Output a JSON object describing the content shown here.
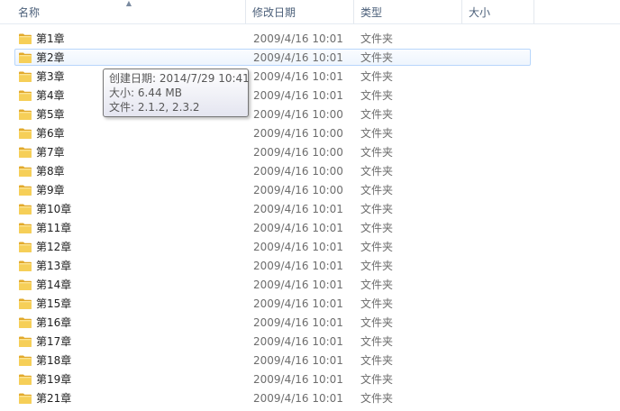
{
  "columns": {
    "name": "名称",
    "date": "修改日期",
    "type": "类型",
    "size": "大小"
  },
  "rows": [
    {
      "name": "第1章",
      "date": "2009/4/16 10:01",
      "type": "文件夹"
    },
    {
      "name": "第2章",
      "date": "2009/4/16 10:01",
      "type": "文件夹"
    },
    {
      "name": "第3章",
      "date": "2009/4/16 10:01",
      "type": "文件夹"
    },
    {
      "name": "第4章",
      "date": "2009/4/16 10:01",
      "type": "文件夹"
    },
    {
      "name": "第5章",
      "date": "2009/4/16 10:00",
      "type": "文件夹"
    },
    {
      "name": "第6章",
      "date": "2009/4/16 10:00",
      "type": "文件夹"
    },
    {
      "name": "第7章",
      "date": "2009/4/16 10:00",
      "type": "文件夹"
    },
    {
      "name": "第8章",
      "date": "2009/4/16 10:00",
      "type": "文件夹"
    },
    {
      "name": "第9章",
      "date": "2009/4/16 10:00",
      "type": "文件夹"
    },
    {
      "name": "第10章",
      "date": "2009/4/16 10:01",
      "type": "文件夹"
    },
    {
      "name": "第11章",
      "date": "2009/4/16 10:01",
      "type": "文件夹"
    },
    {
      "name": "第12章",
      "date": "2009/4/16 10:01",
      "type": "文件夹"
    },
    {
      "name": "第13章",
      "date": "2009/4/16 10:01",
      "type": "文件夹"
    },
    {
      "name": "第14章",
      "date": "2009/4/16 10:01",
      "type": "文件夹"
    },
    {
      "name": "第15章",
      "date": "2009/4/16 10:01",
      "type": "文件夹"
    },
    {
      "name": "第16章",
      "date": "2009/4/16 10:01",
      "type": "文件夹"
    },
    {
      "name": "第17章",
      "date": "2009/4/16 10:01",
      "type": "文件夹"
    },
    {
      "name": "第18章",
      "date": "2009/4/16 10:01",
      "type": "文件夹"
    },
    {
      "name": "第19章",
      "date": "2009/4/16 10:01",
      "type": "文件夹"
    },
    {
      "name": "第21章",
      "date": "2009/4/16 10:01",
      "type": "文件夹"
    }
  ],
  "tooltip": {
    "created": "创建日期: 2014/7/29 10:41",
    "size": "大小: 6.44 MB",
    "files": "文件: 2.1.2, 2.3.2"
  },
  "hovered_row": "第2章",
  "icons": {
    "folder": "folder-icon",
    "sort": "sort-ascending-arrow-icon"
  },
  "colors": {
    "header_text": "#4c607a",
    "hover_border": "#b8d6fb",
    "folder": "#f2c34a",
    "secondary_text": "#6d6d6d"
  }
}
